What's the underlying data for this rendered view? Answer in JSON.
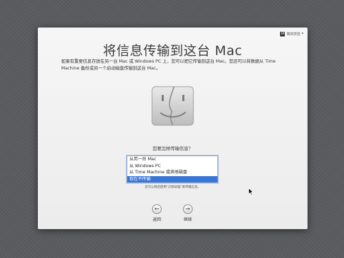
{
  "keyboard_menu": {
    "label": "简体拼音",
    "icon_text": "拼"
  },
  "title": "将信息传输到这台 Mac",
  "description": "如果有重要信息存放在另一台 Mac 或 Windows PC 上，您可以把它传输到这台 Mac。您还可以将数据从 Time Machine 备份或另一个启动磁盘传输到这台 Mac。",
  "question": "您要怎样传输信息？",
  "options": [
    {
      "label": "从另一台 Mac",
      "selected": false
    },
    {
      "label": "从 Windows PC",
      "selected": false
    },
    {
      "label": "从 Time Machine 或其他磁盘",
      "selected": false
    },
    {
      "label": "现在不传输",
      "selected": true
    }
  ],
  "hint": "您可以稍后使用“迁移助理”来传输信息。",
  "buttons": {
    "back": {
      "label": "返回",
      "glyph": "←"
    },
    "continue": {
      "label": "继续",
      "glyph": "→"
    }
  },
  "colors": {
    "selection": "#3875d7",
    "window": "#f0f0f0",
    "background": "#5a5b5e"
  },
  "icons": {
    "finder": "finder-face-icon",
    "cursor": "arrow-cursor-icon"
  }
}
